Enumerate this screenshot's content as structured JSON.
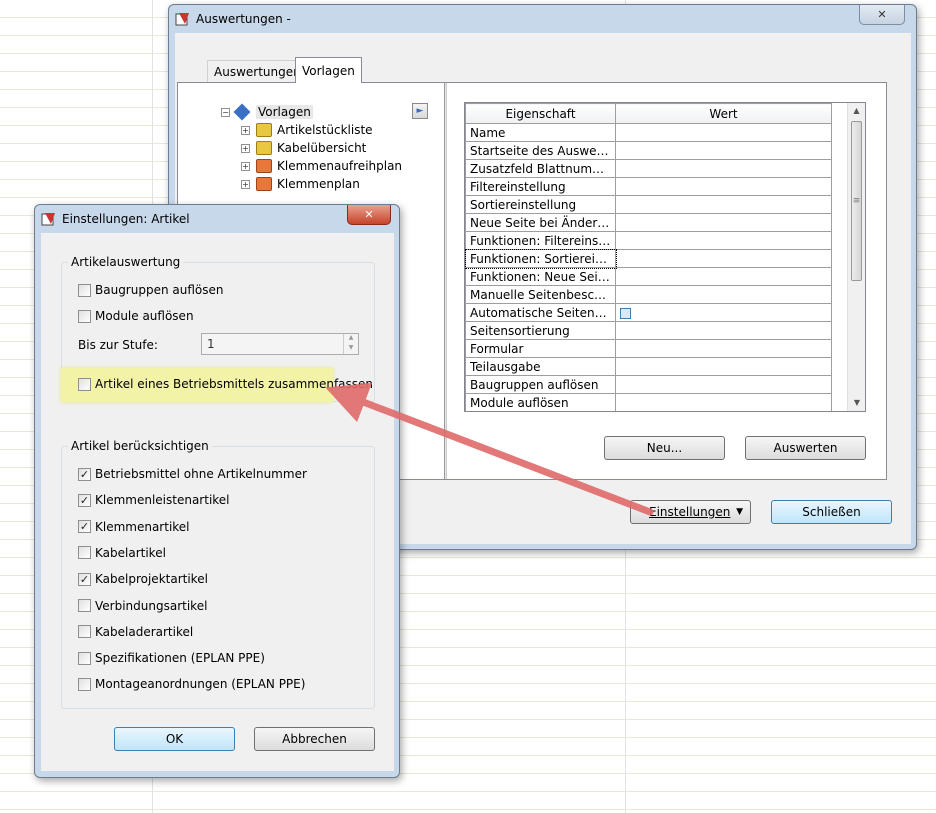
{
  "main": {
    "title": "Auswertungen -",
    "close": "✕",
    "tabs": [
      "Auswertungen",
      "Vorlagen"
    ],
    "tree": {
      "root": "Vorlagen",
      "items": [
        {
          "label": "Artikelstückliste",
          "color": "#e8c840"
        },
        {
          "label": "Kabelübersicht",
          "color": "#e8c840"
        },
        {
          "label": "Klemmenaufreihplan",
          "color": "#e8783a"
        },
        {
          "label": "Klemmenplan",
          "color": "#e8783a"
        }
      ],
      "arrow": "►"
    },
    "table": {
      "headers": [
        "Eigenschaft",
        "Wert"
      ],
      "rows": [
        "Name",
        "Startseite des Auswertun...",
        "Zusatzfeld Blattnummer",
        "Filtereinstellung",
        "Sortiereinstellung",
        "Neue Seite bei Änderung ...",
        "Funktionen: Filtereinstell...",
        "Funktionen: Sortiereinstel...",
        "Funktionen: Neue Seite b...",
        "Manuelle Seitenbeschreib...",
        "Automatische Seitenbesc...",
        "Seitensortierung",
        "Formular",
        "Teilausgabe",
        "Baugruppen auflösen",
        "Module auflösen"
      ]
    },
    "buttons": {
      "neu": "Neu...",
      "auswerten": "Auswerten",
      "einstellungen": "Einstellungen",
      "schliessen": "Schließen",
      "dropdown": "▼"
    }
  },
  "dialog": {
    "title": "Einstellungen: Artikel",
    "close": "✕",
    "group1": {
      "label": "Artikelauswertung",
      "items": [
        {
          "label": "Baugruppen auflösen",
          "checked": false
        },
        {
          "label": "Module auflösen",
          "checked": false
        }
      ],
      "stufe_label": "Bis zur Stufe:",
      "stufe_value": "1",
      "highlighted": {
        "label": "Artikel eines Betriebsmittels zusammenfassen",
        "checked": false
      }
    },
    "group2": {
      "label": "Artikel berücksichtigen",
      "items": [
        {
          "label": "Betriebsmittel ohne Artikelnummer",
          "checked": true
        },
        {
          "label": "Klemmenleistenartikel",
          "checked": true
        },
        {
          "label": "Klemmenartikel",
          "checked": true
        },
        {
          "label": "Kabelartikel",
          "checked": false
        },
        {
          "label": "Kabelprojektartikel",
          "checked": true
        },
        {
          "label": "Verbindungsartikel",
          "checked": false
        },
        {
          "label": "Kabeladerartikel",
          "checked": false
        },
        {
          "label": "Spezifikationen (EPLAN PPE)",
          "checked": false
        },
        {
          "label": "Montageanordnungen (EPLAN PPE)",
          "checked": false
        }
      ]
    },
    "ok": "OK",
    "cancel": "Abbrechen"
  },
  "colors": {
    "highlight": "#f3f3a8",
    "arrow": "#e06a6a"
  }
}
